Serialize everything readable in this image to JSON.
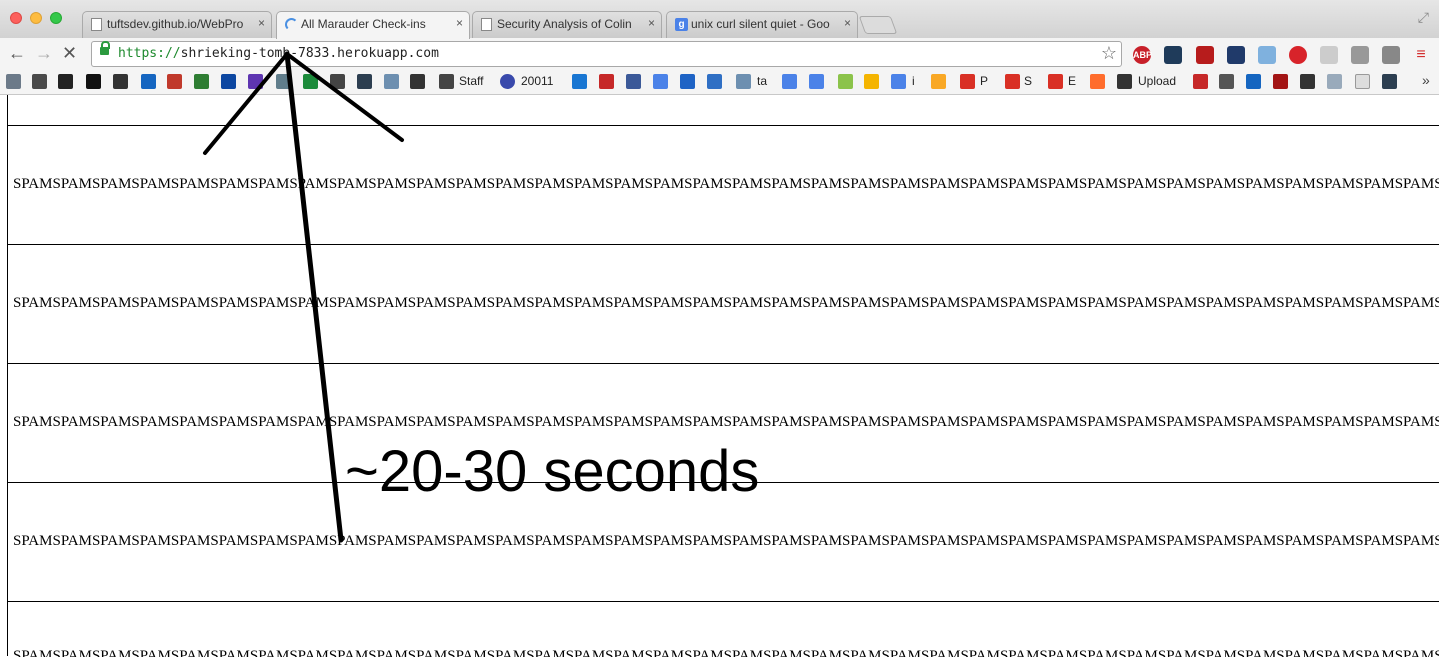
{
  "browser": {
    "tabs": [
      {
        "title": "tuftsdev.github.io/WebPro",
        "icon": "page-icon",
        "active": false
      },
      {
        "title": "All Marauder Check-ins",
        "icon": "loading-spinner-icon",
        "active": true
      },
      {
        "title": "Security Analysis of Colin",
        "icon": "page-icon",
        "active": false
      },
      {
        "title": "unix curl silent quiet - Goo",
        "icon": "google-icon",
        "active": false
      }
    ],
    "tab_close_glyph": "×",
    "address": {
      "scheme": "https://",
      "host": "shrieking-tomb-7833.herokuapp.com"
    },
    "bookmarks": {
      "staff": "Staff",
      "num": "20011",
      "ta": "ta",
      "i": "i",
      "p": "P",
      "s": "S",
      "e": "E",
      "upload": "Upload",
      "overflow": "»"
    }
  },
  "page": {
    "row_text": "SPAMSPAMSPAMSPAMSPAMSPAMSPAMSPAMSPAMSPAMSPAMSPAMSPAMSPAMSPAMSPAMSPAMSPAMSPAMSPAMSPAMSPAMSPAMSPAMSPAMSPAMSPAMSPAMSPAMSPAMSPAMSPAMSPAMSPAMSPAMSPAMSPAMSPAMSPAMSPAMSPAMSPAMSPAMSPAMSPAMSPAM"
  },
  "annotation": {
    "text": "~20-30 seconds",
    "color": "#000000"
  },
  "colors": {
    "secure_green": "#1e8a2e",
    "tabstrip_bg": "#d6d6d6"
  }
}
